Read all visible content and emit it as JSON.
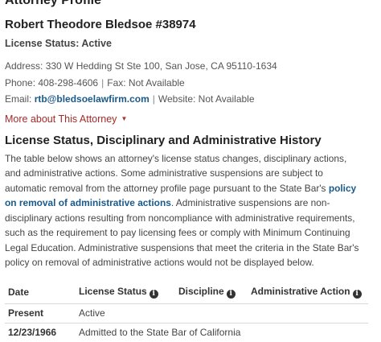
{
  "profile": {
    "section_title": "Attorney Profile",
    "name": "Robert Theodore Bledsoe #38974",
    "license_status": "License Status: Active",
    "address": "Address: 330 W Hedding St Ste 100, San Jose, CA 95110-1634",
    "phone": "Phone: 408-298-4606",
    "fax": "Fax: Not Available",
    "email_label": "Email: ",
    "email_value": "rtb@bledsoelawfirm.com",
    "website": "Website: Not Available",
    "separator": "|",
    "more_link": "More about This Attorney",
    "more_icon": "caret-down-icon"
  },
  "history": {
    "title": "License Status, Disciplinary and Administrative History",
    "para_1": "The table below shows an attorney's license status changes, disciplinary actions, and administrative actions. Some administrative suspensions are subject to automatic removal from the attorney profile page pursuant to the State Bar's ",
    "policy_link": "policy on removal of administrative actions",
    "para_2": ". Administrative suspensions are non-disciplinary actions resulting from noncompliance with administrative requirements, such as the requirement to pay licensing fees or comply with Minimum Continuing Legal Education. Administrative suspensions that meet the criteria in the State Bar's policy on removal of administrative actions would not be displayed below.",
    "columns": {
      "date": "Date",
      "license_status": "License Status",
      "discipline": "Discipline",
      "administrative_action": "Administrative Action"
    },
    "info_icon": "info-circle-icon",
    "rows": [
      {
        "date": "Present",
        "license_status": "Active",
        "discipline": "",
        "administrative_action": ""
      },
      {
        "date": "12/23/1966",
        "license_status": "Admitted to the State Bar of California",
        "discipline": "",
        "administrative_action": ""
      }
    ]
  }
}
